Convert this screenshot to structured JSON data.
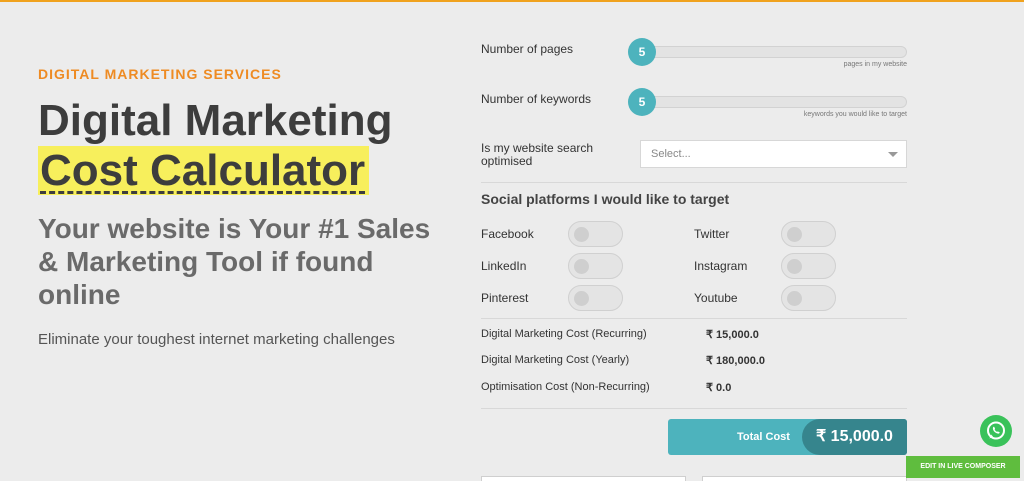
{
  "hero": {
    "eyebrow": "DIGITAL MARKETING SERVICES",
    "title_line1": "Digital Marketing",
    "title_line2": "Cost Calculator",
    "subhead": "Your website is Your #1 Sales & Marketing Tool if found online",
    "tagline": "Eliminate your toughest internet marketing challenges"
  },
  "calculator": {
    "pages": {
      "label": "Number of pages",
      "value": "5",
      "hint": "pages in my website"
    },
    "keywords": {
      "label": "Number of keywords",
      "value": "5",
      "hint": "keywords you would like to target"
    },
    "seo": {
      "label": "Is my website search optimised",
      "selected": "Select..."
    },
    "social": {
      "title": "Social platforms I would like to target",
      "platforms": [
        {
          "name": "Facebook",
          "enabled": false
        },
        {
          "name": "Twitter",
          "enabled": false
        },
        {
          "name": "LinkedIn",
          "enabled": false
        },
        {
          "name": "Instagram",
          "enabled": false
        },
        {
          "name": "Pinterest",
          "enabled": false
        },
        {
          "name": "Youtube",
          "enabled": false
        }
      ]
    },
    "costs": [
      {
        "label": "Digital Marketing Cost (Recurring)",
        "value": "₹ 15,000.0"
      },
      {
        "label": "Digital Marketing Cost (Yearly)",
        "value": "₹ 180,000.0"
      },
      {
        "label": "Optimisation Cost (Non-Recurring)",
        "value": "₹ 0.0"
      }
    ],
    "total": {
      "label": "Total Cost",
      "value": "₹ 15,000.0"
    }
  },
  "floating": {
    "whatsapp_icon": "whatsapp-icon",
    "live_composer_label": "EDIT IN LIVE COMPOSER"
  },
  "colors": {
    "accent_orange": "#ee8b23",
    "teal": "#4db3bd",
    "teal_dark": "#36858d",
    "highlight_yellow": "#f7ef5c",
    "whatsapp_green": "#3ac25a",
    "composer_green": "#5fbd3e"
  }
}
